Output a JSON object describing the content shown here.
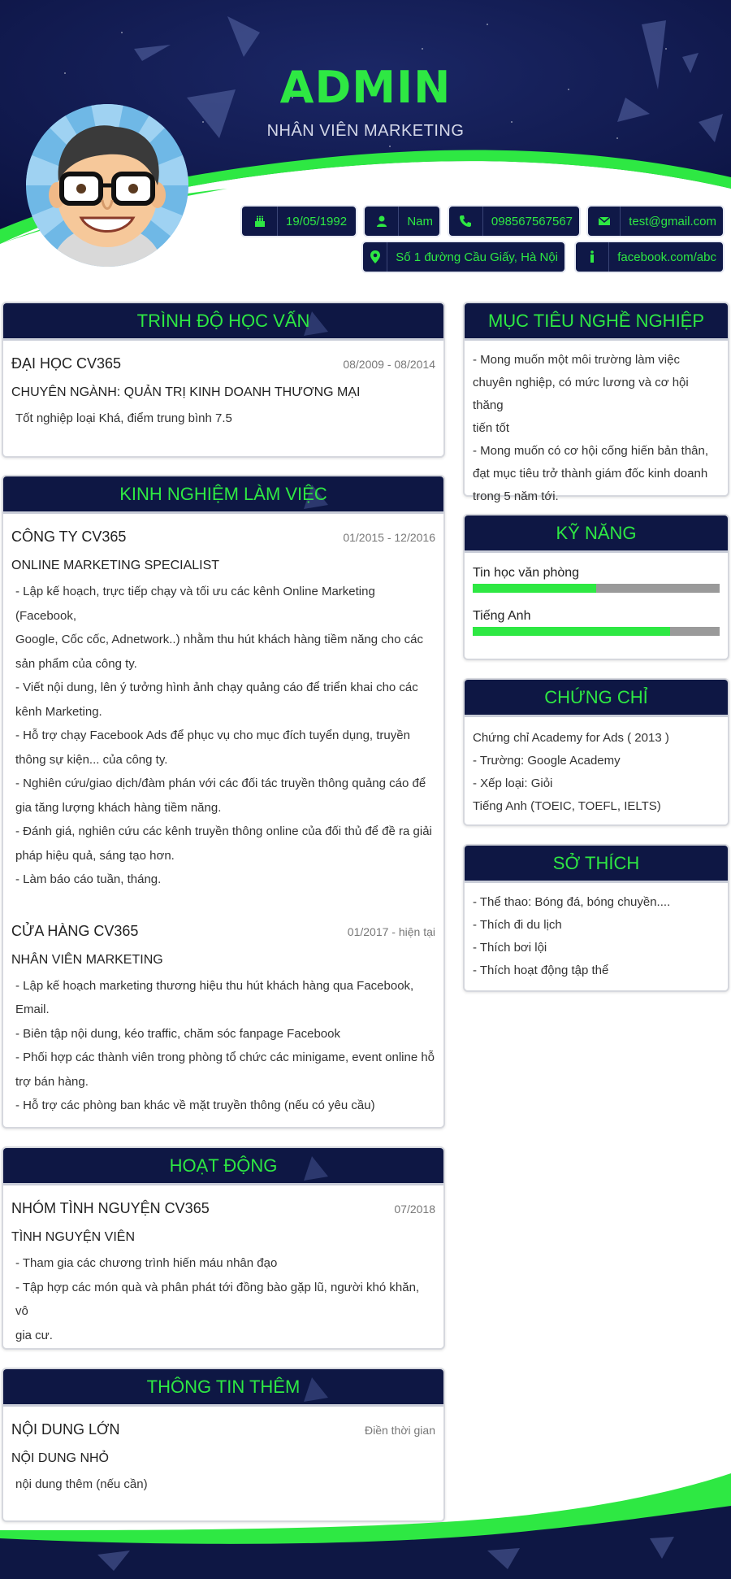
{
  "header": {
    "name": "ADMIN",
    "job_title": "NHÂN VIÊN MARKETING"
  },
  "contacts": [
    {
      "icon": "birthday-cake-icon",
      "value": "19/05/1992"
    },
    {
      "icon": "user-icon",
      "value": "Nam"
    },
    {
      "icon": "phone-icon",
      "value": "098567567567"
    },
    {
      "icon": "envelope-icon",
      "value": "test@gmail.com"
    },
    {
      "icon": "map-marker-icon",
      "value": "Số 1 đường Cầu Giấy, Hà Nội"
    },
    {
      "icon": "info-icon",
      "value": "facebook.com/abc"
    }
  ],
  "education": {
    "heading": "TRÌNH ĐỘ HỌC VẤN",
    "school": "ĐẠI HỌC CV365",
    "date": "08/2009 - 08/2014",
    "major": "CHUYÊN NGÀNH: QUẢN TRỊ KINH DOANH THƯƠNG MẠI",
    "desc": "Tốt nghiệp loại Khá, điểm trung bình 7.5"
  },
  "experience": {
    "heading": "KINH NGHIỆM LÀM VIỆC",
    "jobs": [
      {
        "company": "CÔNG TY CV365",
        "date": "01/2015 - 12/2016",
        "role": "ONLINE MARKETING SPECIALIST",
        "desc": [
          "- Lập kế hoạch, trực tiếp chạy và tối ưu các kênh Online Marketing (Facebook,",
          "Google, Cốc cốc, Adnetwork..) nhằm thu hút khách hàng tiềm năng cho các",
          "sản phẩm của công ty.",
          "- Viết nội dung, lên ý tưởng hình ảnh chạy quảng cáo để triển khai cho các",
          "kênh Marketing.",
          "- Hỗ trợ chạy Facebook Ads để phục vụ cho mục đích tuyển dụng, truyền",
          "thông sự kiện... của công ty.",
          "- Nghiên cứu/giao dịch/đàm phán với các đối tác truyền thông quảng cáo để",
          "gia tăng lượng khách hàng tiềm năng.",
          "- Đánh giá, nghiên cứu các kênh truyền thông online của đối thủ để đề ra giải",
          "pháp hiệu quả, sáng tạo hơn.",
          "- Làm báo cáo tuần, tháng."
        ]
      },
      {
        "company": "CỬA HÀNG CV365",
        "date": "01/2017 - hiện tại",
        "role": "NHÂN VIÊN MARKETING",
        "desc": [
          "- Lập kế hoạch marketing thương hiệu thu hút khách hàng qua Facebook,",
          "Email.",
          "- Biên tập nội dung, kéo traffic, chăm sóc fanpage Facebook",
          "- Phối hợp các thành viên trong phòng tổ chức các minigame, event online hỗ",
          "trợ bán hàng.",
          "- Hỗ trợ các phòng ban khác về mặt truyền thông (nếu có yêu cầu)"
        ]
      }
    ]
  },
  "activities": {
    "heading": "HOẠT ĐỘNG",
    "org": "NHÓM TÌNH NGUYỆN CV365",
    "date": "07/2018",
    "role": "TÌNH NGUYỆN VIÊN",
    "desc": [
      "- Tham gia các chương trình hiến máu nhân đạo",
      "- Tập hợp các món quà và phân phát tới đồng bào gặp lũ, người khó khăn, vô",
      "gia cư."
    ]
  },
  "additional": {
    "heading": "THÔNG TIN THÊM",
    "title": "NỘI DUNG LỚN",
    "date": "Điền thời gian",
    "subtitle": "NỘI DUNG NHỎ",
    "desc": "nội dung thêm (nếu cần)"
  },
  "objective": {
    "heading": "MỤC TIÊU NGHỀ NGHIỆP",
    "lines": [
      "- Mong muốn một môi trường làm việc",
      "chuyên nghiệp, có mức lương và cơ hội thăng",
      "tiến tốt",
      "- Mong muốn có cơ hội cống hiến bản thân,",
      "đạt mục tiêu trở thành giám đốc kinh doanh",
      "trong 5 năm tới."
    ]
  },
  "skills": {
    "heading": "KỸ NĂNG",
    "items": [
      {
        "name": "Tin học văn phòng",
        "level": 0.5
      },
      {
        "name": "Tiếng Anh",
        "level": 0.8
      }
    ]
  },
  "certificates": {
    "heading": "CHỨNG CHỈ",
    "lines": [
      "Chứng chỉ  Academy for Ads ( 2013 )",
      "- Trường: Google Academy",
      "- Xếp loại: Giỏi",
      "Tiếng Anh (TOEIC, TOEFL, IELTS)"
    ]
  },
  "hobbies": {
    "heading": "SỞ THÍCH",
    "lines": [
      "- Thể thao: Bóng đá, bóng chuyền....",
      "- Thích đi du lịch",
      "- Thích bơi lội",
      "- Thích hoạt động tập thể"
    ]
  },
  "colors": {
    "navy": "#0e1744",
    "accent_green": "#2ee843"
  }
}
